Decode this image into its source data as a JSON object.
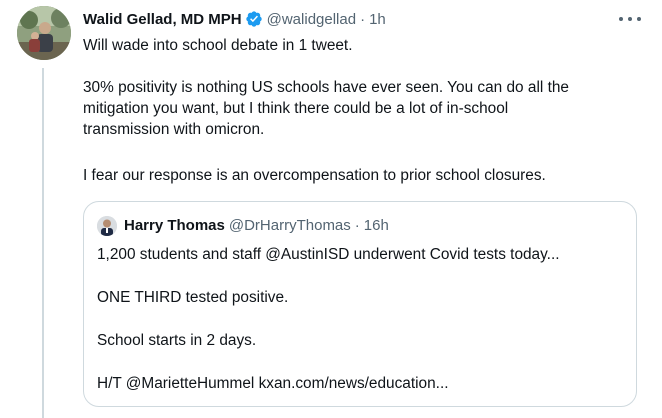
{
  "tweet": {
    "author_name": "Walid Gellad, MD MPH",
    "handle": "@walidgellad",
    "separator": "·",
    "time": "1h",
    "text_lines": [
      "Will wade into school debate in 1 tweet.",
      "30% positivity is nothing US schools have ever seen. You can do all the",
      "mitigation you want, but I think there could be a lot of in-school",
      "transmission with omicron.",
      "I fear our response is an overcompensation to prior school closures."
    ]
  },
  "quoted_tweet": {
    "author_name": "Harry Thomas",
    "handle": "@DrHarryThomas",
    "separator": "·",
    "time": "16h",
    "text_lines": [
      "1,200 students and staff @AustinISD underwent Covid tests today...",
      "ONE THIRD tested positive.",
      "School starts in 2 days.",
      "H/T @MarietteHummel kxan.com/news/education..."
    ]
  },
  "colors": {
    "text_primary": "#0f1419",
    "text_secondary": "#536471",
    "verified_blue": "#1d9bf0",
    "border": "#cfd9de"
  },
  "icons": {
    "verified": "verified-badge-icon",
    "more": "more-options-icon"
  }
}
